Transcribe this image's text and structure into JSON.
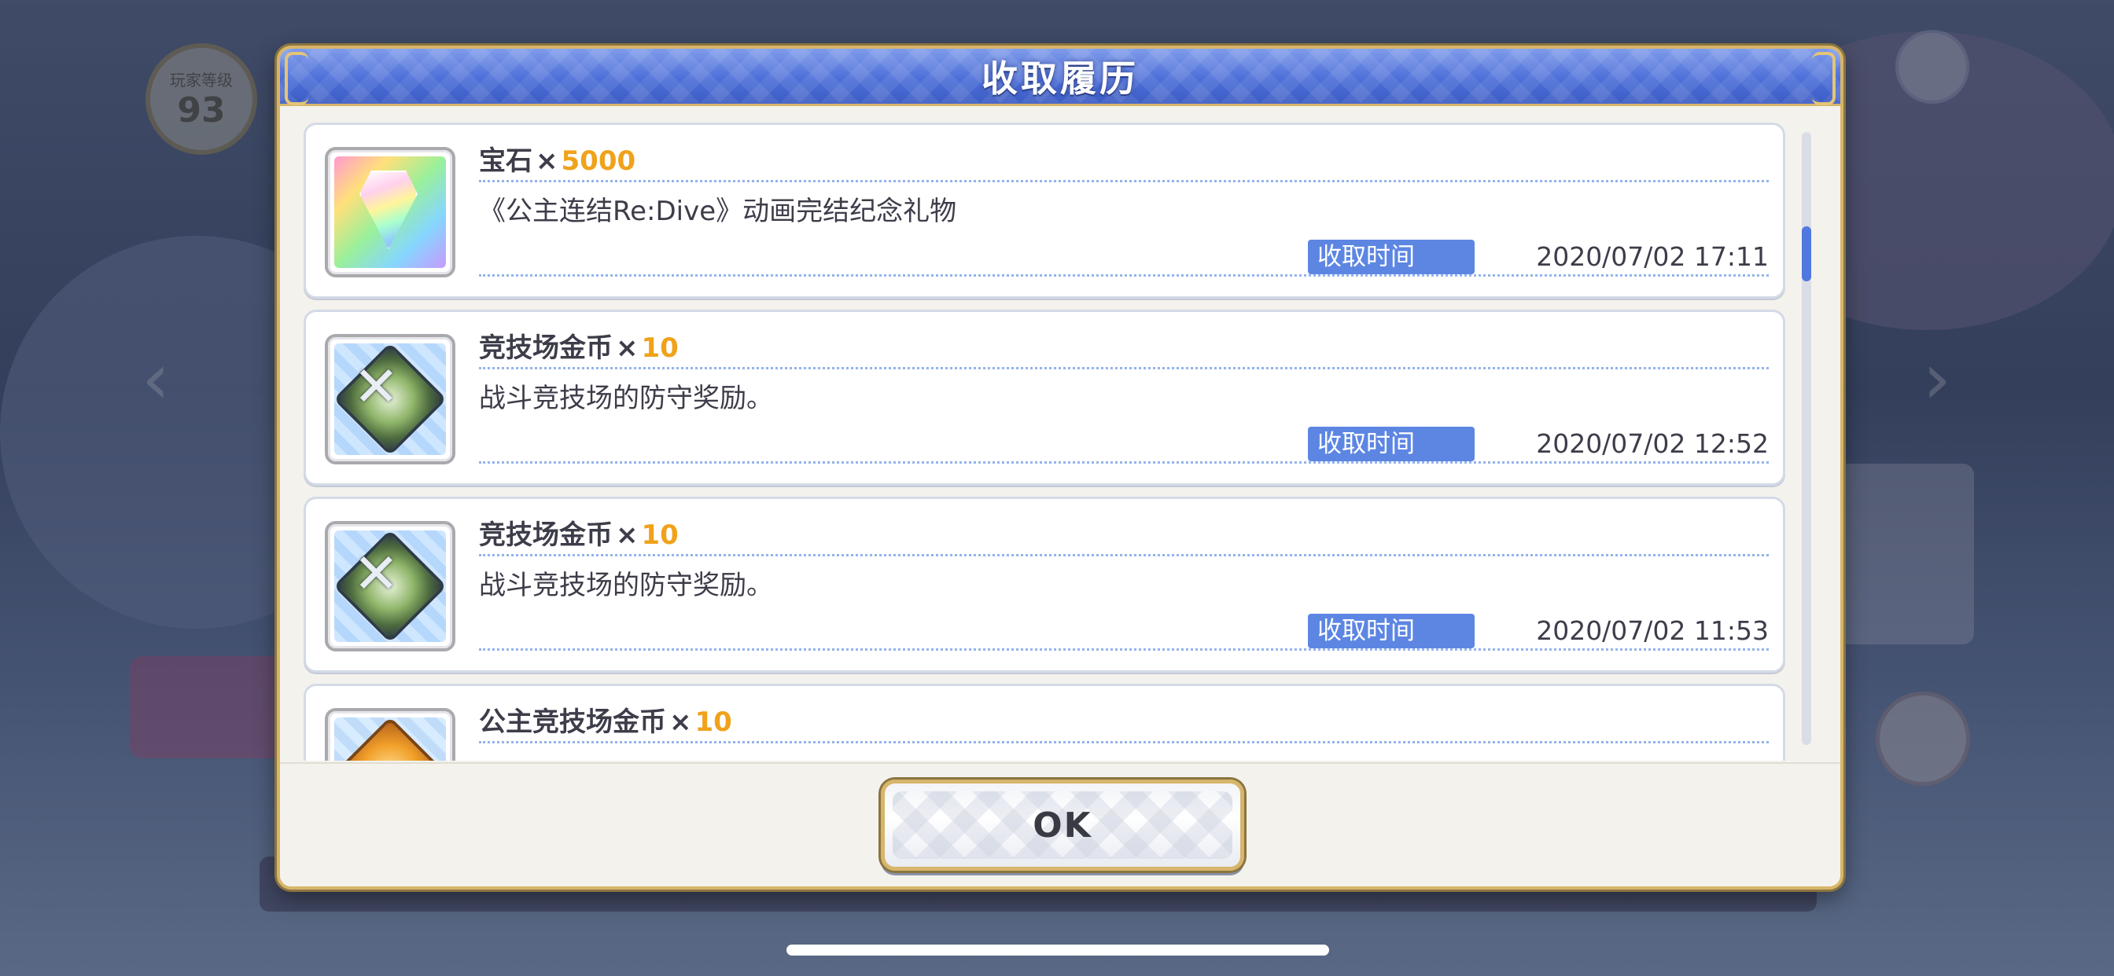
{
  "dialog": {
    "title": "收取履历",
    "ok_label": "OK"
  },
  "background": {
    "level_label": "玩家等级",
    "level_value": "93"
  },
  "items": [
    {
      "name": "宝石",
      "mult": "×",
      "qty": "5000",
      "description": "《公主连结Re:Dive》动画完结纪念礼物",
      "time_label": "收取时间",
      "time_value": "2020/07/02 17:11",
      "icon": "rainbow-gem-icon"
    },
    {
      "name": "竞技场金币",
      "mult": "×",
      "qty": "10",
      "description": "战斗竞技场的防守奖励。",
      "time_label": "收取时间",
      "time_value": "2020/07/02 12:52",
      "icon": "arena-coin-icon"
    },
    {
      "name": "竞技场金币",
      "mult": "×",
      "qty": "10",
      "description": "战斗竞技场的防守奖励。",
      "time_label": "收取时间",
      "time_value": "2020/07/02 11:53",
      "icon": "arena-coin-icon"
    },
    {
      "name": "公主竞技场金币",
      "mult": "×",
      "qty": "10",
      "description": "",
      "time_label": "",
      "time_value": "",
      "icon": "princess-arena-coin-icon"
    }
  ],
  "colors": {
    "title_bar": "#4d6fd8",
    "quantity": "#f0a21b",
    "time_label_bg": "#5d86e3",
    "frame_gold": "#d7b56a"
  }
}
